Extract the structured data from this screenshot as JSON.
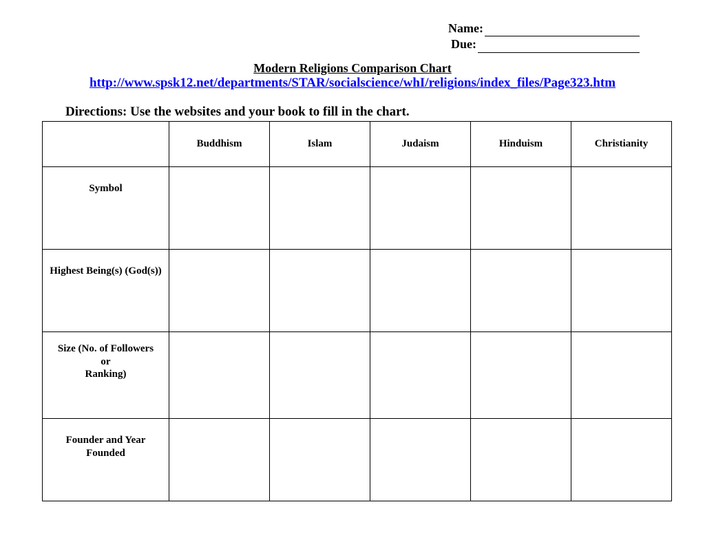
{
  "header": {
    "name_label": "Name:",
    "due_label": "Due:"
  },
  "title": "Modern Religions Comparison Chart",
  "url": "http://www.spsk12.net/departments/STAR/socialscience/whI/religions/index_files/Page323.htm",
  "directions": "Directions:  Use the websites and your book to fill in the chart.",
  "chart_data": {
    "type": "table",
    "columns": [
      "Buddhism",
      "Islam",
      "Judaism",
      "Hinduism",
      "Christianity"
    ],
    "rows": [
      {
        "label": "Symbol"
      },
      {
        "label": "Highest Being(s) (God(s))"
      },
      {
        "label_line1": "Size (No. of Followers",
        "label_line2": "or",
        "label_line3": "Ranking)"
      },
      {
        "label": "Founder and Year Founded"
      }
    ]
  }
}
